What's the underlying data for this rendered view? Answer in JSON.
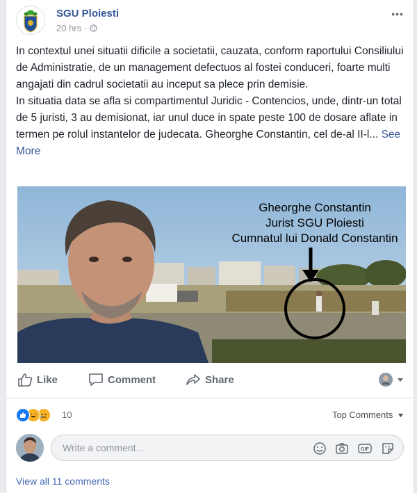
{
  "header": {
    "page_name": "SGU Ploiesti",
    "time": "20 hrs",
    "more": "•••"
  },
  "post": {
    "paragraph1": "In contextul unei situatii dificile a societatii, cauzata, conform raportului Consiliului de Administratie, de un management defectuos al fostei conduceri, foarte multi angajati din cadrul societatii au inceput sa plece prin demisie.",
    "paragraph2": "In situatia data se afla si compartimentul Juridic - Contencios, unde, dintr-un total de 5 juristi, 3 au demisionat, iar unul duce in spate peste 100 de dosare aflate in termen pe rolul instantelor de judecata. Gheorghe Constantin, cel de-al II-l...",
    "see_more": "See More"
  },
  "photo": {
    "caption_line1": "Gheorghe Constantin",
    "caption_line2": "Jurist SGU Ploiesti",
    "caption_line3": "Cumnatul lui Donald Constantin"
  },
  "actions": {
    "like": "Like",
    "comment": "Comment",
    "share": "Share"
  },
  "reactions": {
    "count": "10",
    "top_comments": "Top Comments"
  },
  "comment_box": {
    "placeholder": "Write a comment..."
  },
  "view_all": "View all 11 comments",
  "colors": {
    "link": "#365899",
    "like_blue": "#1877f2",
    "haha_yellow": "#f7b125"
  }
}
